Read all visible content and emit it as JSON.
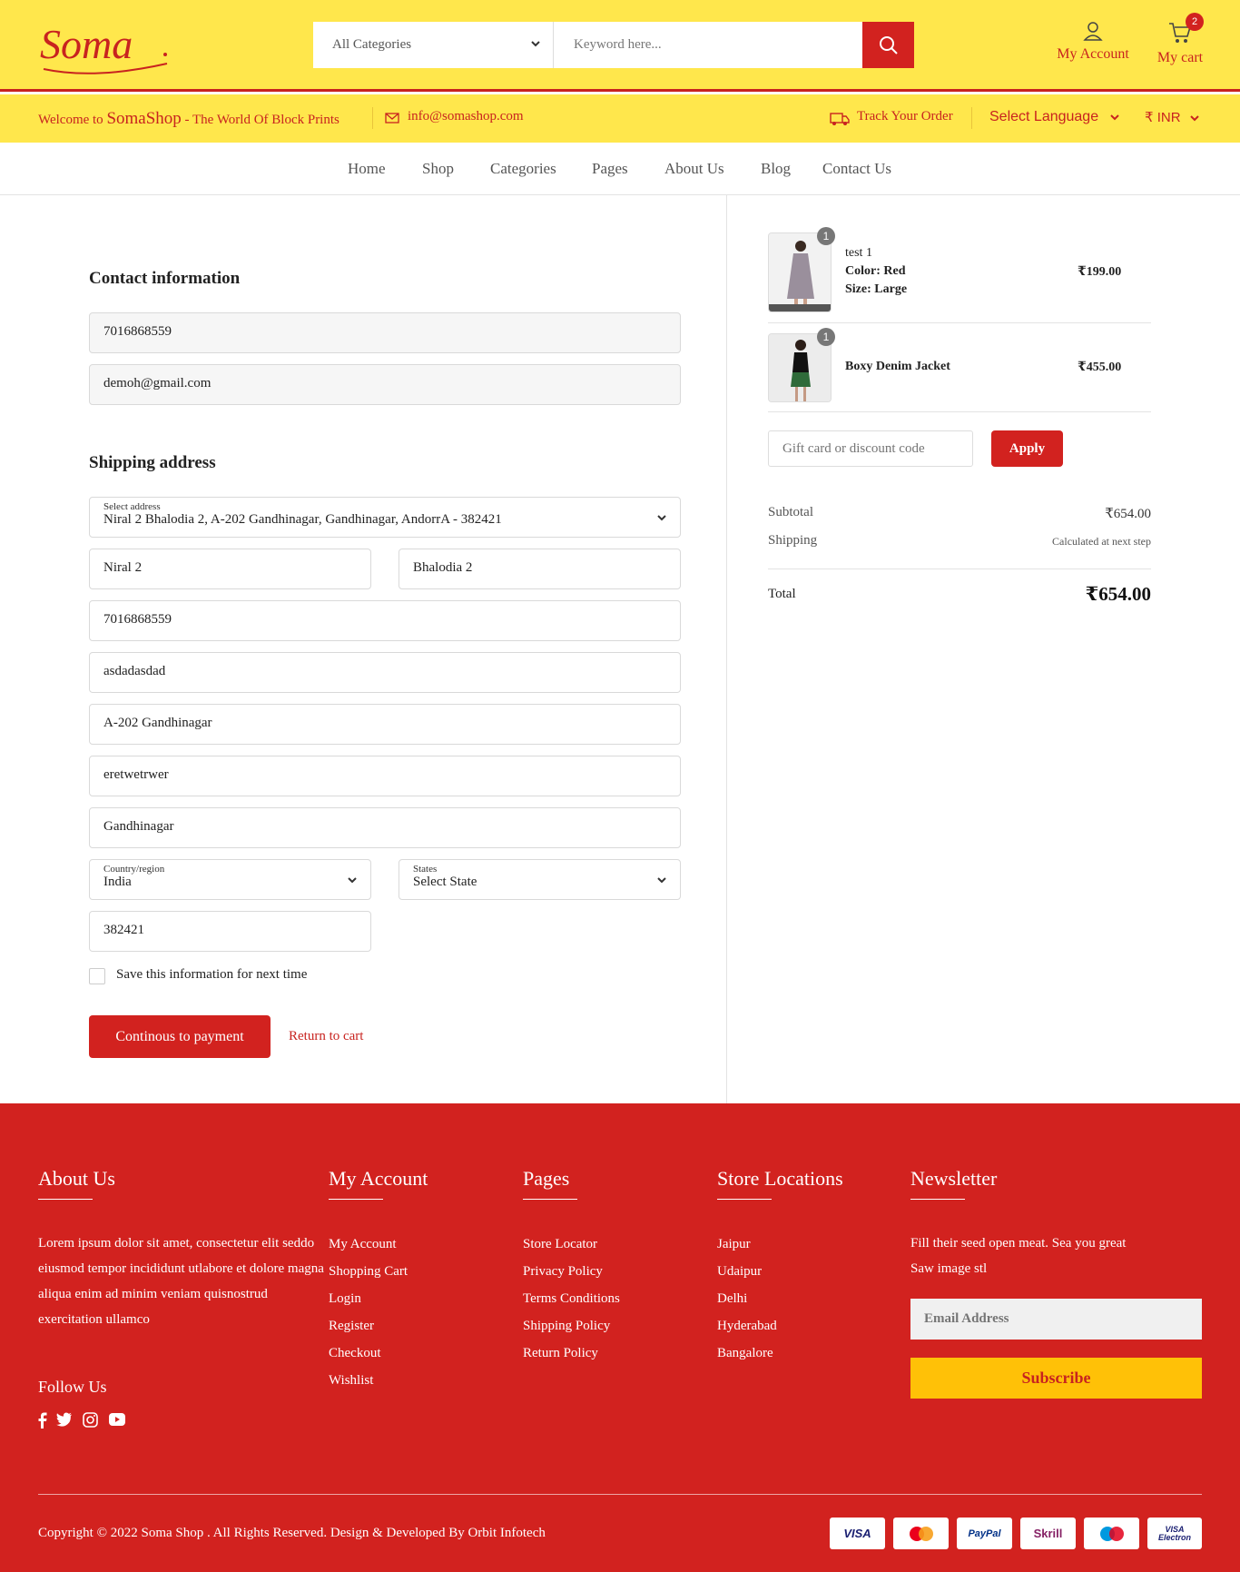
{
  "header": {
    "logo_text": "Soma",
    "category_select": "All Categories",
    "search_placeholder": "Keyword here...",
    "account_label": "My Account",
    "cart_label": "My cart",
    "cart_count": "2"
  },
  "topbar": {
    "welcome_prefix": "Welcome to ",
    "welcome_brand": "SomaShop",
    "welcome_suffix": " - The World Of Block Prints",
    "email": "info@somashop.com",
    "track_order": "Track Your Order",
    "language": "Select Language",
    "currency": "₹ INR"
  },
  "nav": [
    "Home",
    "Shop",
    "Categories",
    "Pages",
    "About Us",
    "Blog",
    "Contact Us"
  ],
  "contact": {
    "heading": "Contact information",
    "phone": "7016868559",
    "email": "demoh@gmail.com"
  },
  "shipping": {
    "heading": "Shipping address",
    "select_address_label": "Select address",
    "select_address_value": "Niral 2 Bhalodia 2, A-202 Gandhinagar, Gandhinagar, AndorrA - 382421",
    "first_name": "Niral 2",
    "last_name": "Bhalodia 2",
    "phone": "7016868559",
    "company": "asdadasdad",
    "address1": "A-202 Gandhinagar",
    "address2": "eretwetrwer",
    "city": "Gandhinagar",
    "country_label": "Country/region",
    "country_value": "India",
    "state_label": "States",
    "state_value": "Select State",
    "zip": "382421",
    "save_info": "Save this information for next time",
    "continue_button": "Continous to payment",
    "return_link": "Return to cart"
  },
  "summary": {
    "items": [
      {
        "qty": "1",
        "name": "test 1",
        "color": "Color: Red",
        "size": "Size: Large",
        "price": "₹199.00"
      },
      {
        "qty": "1",
        "name": "Boxy Denim Jacket",
        "price": "₹455.00"
      }
    ],
    "discount_placeholder": "Gift card or discount code",
    "apply_button": "Apply",
    "subtotal_label": "Subtotal",
    "subtotal_value": "₹654.00",
    "shipping_label": "Shipping",
    "shipping_value": "Calculated at next step",
    "total_label": "Total",
    "total_value": "₹654.00"
  },
  "footer": {
    "about": {
      "heading": "About Us",
      "text": "Lorem ipsum dolor sit amet, consectetur elit seddo eiusmod tempor incididunt utlabore et dolore magna aliqua enim ad minim veniam quisnostrud exercitation ullamco",
      "follow": "Follow Us"
    },
    "account": {
      "heading": "My Account",
      "links": [
        "My Account",
        "Shopping Cart",
        "Login",
        "Register",
        "Checkout",
        "Wishlist"
      ]
    },
    "pages": {
      "heading": "Pages",
      "links": [
        "Store Locator",
        "Privacy Policy",
        "Terms Conditions",
        "Shipping Policy",
        "Return Policy"
      ]
    },
    "stores": {
      "heading": "Store Locations",
      "links": [
        "Jaipur",
        "Udaipur",
        "Delhi",
        "Hyderabad",
        "Bangalore"
      ]
    },
    "newsletter": {
      "heading": "Newsletter",
      "text": "Fill their seed open meat. Sea you great Saw image stl",
      "email_placeholder": "Email Address",
      "subscribe": "Subscribe"
    },
    "copyright": "Copyright © 2022 Soma Shop . All Rights Reserved. Design & Developed By Orbit Infotech",
    "payments": [
      "VISA",
      "MasterCard",
      "PayPal",
      "Skrill",
      "Maestro",
      "VISA Electron"
    ]
  },
  "colors": {
    "brand_red": "#d2221f",
    "header_yellow": "#ffe74c",
    "subscribe_yellow": "#ffc107"
  }
}
